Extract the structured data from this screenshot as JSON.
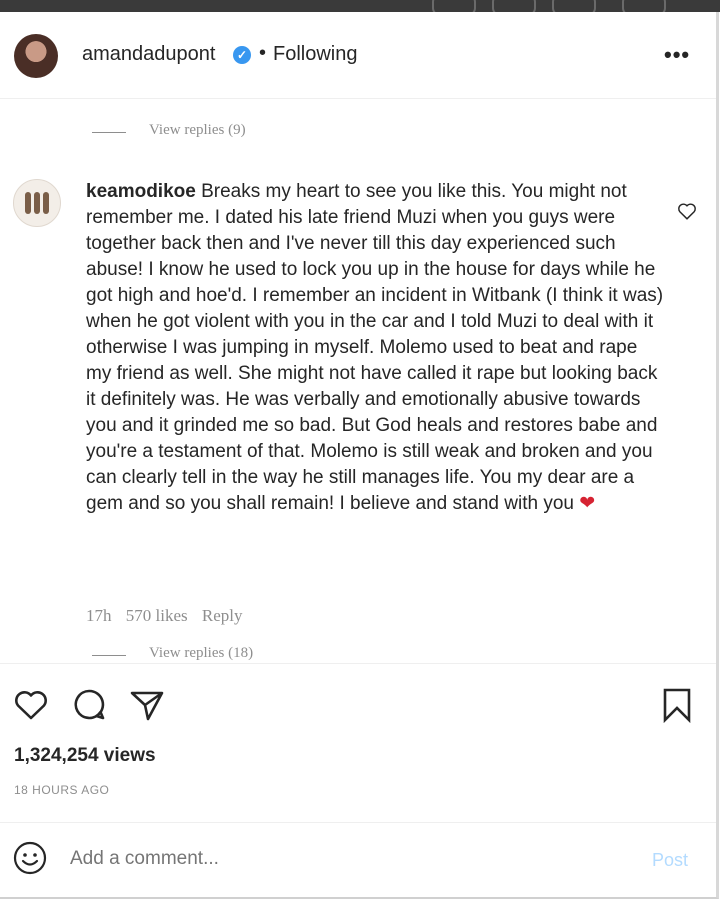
{
  "header": {
    "username": "amandadupont",
    "separator": "•",
    "follow_status": "Following",
    "more_label": "•••"
  },
  "replies_top": {
    "label": "View replies (9)"
  },
  "comment": {
    "username": "keamodikoe",
    "text": "Breaks my heart to see you like this. You might not remember me. I dated his late friend Muzi when you guys were together back then and I've never till this day experienced such abuse! I know he used to lock you up in the house for days while he got high and hoe'd. I remember an incident in Witbank (I think it was) when he got violent with you in the car and I told Muzi to deal with it otherwise I was jumping in myself. Molemo used to beat and rape my friend as well. She might not have called it rape but looking back it definitely was. He was verbally and emotionally abusive towards you and it grinded me so bad. But God heals and restores babe and you're a testament of that. Molemo is still weak and broken and you can clearly tell in the way he still manages life. You my dear are a gem and so you shall remain! I believe and stand with you",
    "emoji": "❤",
    "time": "17h",
    "likes": "570 likes",
    "reply_label": "Reply"
  },
  "replies_bottom": {
    "label": "View replies (18)"
  },
  "stats": {
    "views": "1,324,254 views",
    "posted_ago": "18 HOURS AGO"
  },
  "comment_box": {
    "placeholder": "Add a comment...",
    "post_label": "Post"
  },
  "colors": {
    "verified": "#3897f0",
    "heart": "#d62332",
    "muted": "#8e8e8e",
    "post_disabled": "#b3dbff"
  }
}
